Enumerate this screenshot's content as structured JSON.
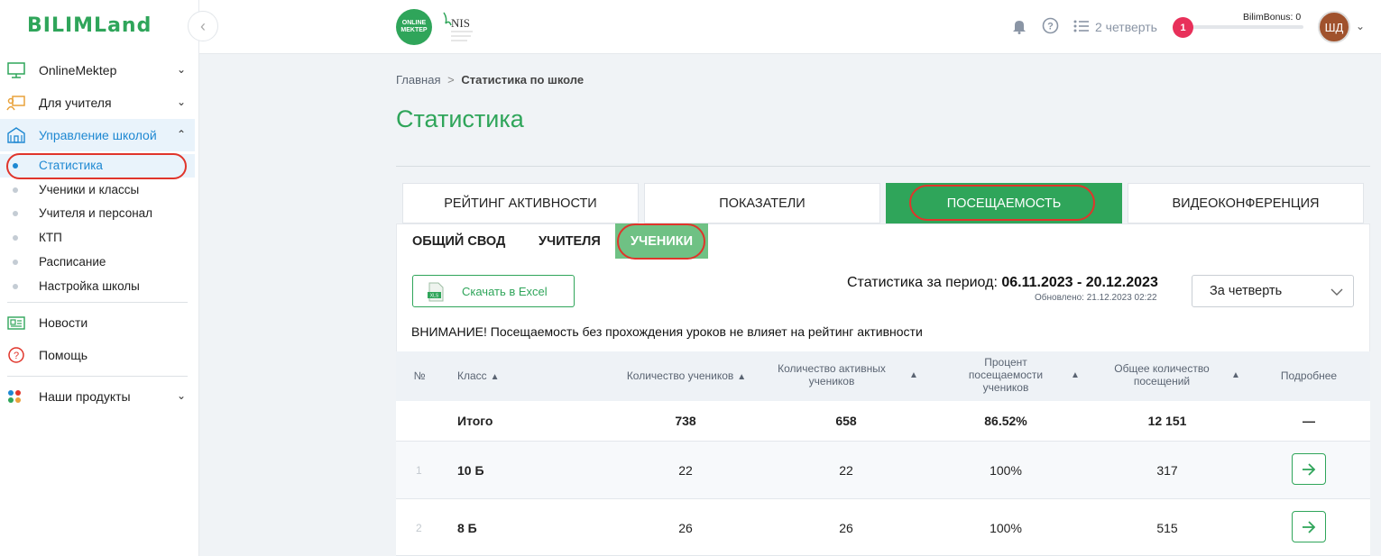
{
  "sidebar": {
    "logo": "BILIMLand",
    "items": [
      {
        "label": "OnlineMektep"
      },
      {
        "label": "Для учителя"
      },
      {
        "label": "Управление школой"
      },
      {
        "label": "Новости"
      },
      {
        "label": "Помощь"
      },
      {
        "label": "Наши продукты"
      }
    ],
    "subitems": [
      "Статистика",
      "Ученики и классы",
      "Учителя и персонал",
      "КТП",
      "Расписание",
      "Настройка школы"
    ]
  },
  "header": {
    "online_mektep_logo": "ONLINE MEKTEP",
    "nis_logo": "NIS",
    "quarter": "2 четверть",
    "bonus_label": "BilimBonus: 0",
    "bonus_badge": "1",
    "avatar": "ШД"
  },
  "breadcrumb": {
    "home": "Главная",
    "separator": ">",
    "current": "Статистика по школе"
  },
  "page_title": "Статистика",
  "tabs": [
    "РЕЙТИНГ АКТИВНОСТИ",
    "ПОКАЗАТЕЛИ",
    "ПОСЕЩАЕМОСТЬ",
    "ВИДЕОКОНФЕРЕНЦИЯ"
  ],
  "subtabs": [
    "ОБЩИЙ СВОД",
    "УЧИТЕЛЯ",
    "УЧЕНИКИ"
  ],
  "toolbar": {
    "excel_label": "Скачать в Excel",
    "period_label": "Статистика за период:",
    "period_value": "06.11.2023 - 20.12.2023",
    "updated": "Обновлено: 21.12.2023 02:22",
    "select_value": "За четверть"
  },
  "warning": "ВНИМАНИЕ! Посещаемость без прохождения уроков не влияет на рейтинг активности",
  "table": {
    "headers": {
      "num": "№",
      "klass": "Класс",
      "students": "Количество учеников",
      "active": "Количество активных учеников",
      "percent": "Процент посещаемости учеников",
      "visits": "Общее количество посещений",
      "details": "Подробнее"
    },
    "total": {
      "label": "Итого",
      "students": "738",
      "active": "658",
      "percent": "86.52%",
      "visits": "12 151",
      "details": "—"
    },
    "rows": [
      {
        "num": "1",
        "klass": "10 Б",
        "students": "22",
        "active": "22",
        "percent": "100%",
        "visits": "317"
      },
      {
        "num": "2",
        "klass": "8 Б",
        "students": "26",
        "active": "26",
        "percent": "100%",
        "visits": "515"
      }
    ]
  },
  "colors": {
    "brand_green": "#2fa55a",
    "active_blue": "#1e88d2",
    "highlight_red": "#e0352b",
    "badge_pink": "#e8305a"
  }
}
